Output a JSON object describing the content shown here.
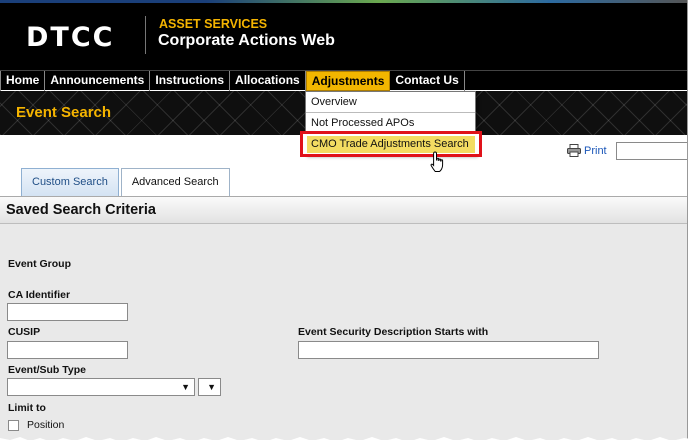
{
  "header": {
    "logo": "DTCC",
    "super_title": "ASSET SERVICES",
    "app_title": "Corporate Actions Web"
  },
  "nav": {
    "items": [
      {
        "label": "Home"
      },
      {
        "label": "Announcements"
      },
      {
        "label": "Instructions"
      },
      {
        "label": "Allocations"
      },
      {
        "label": "Adjustments"
      },
      {
        "label": "Contact Us"
      }
    ],
    "active": "Adjustments"
  },
  "band": {
    "title": "Event Search"
  },
  "dropdown": {
    "items": [
      {
        "label": "Overview"
      },
      {
        "label": "Not Processed APOs"
      },
      {
        "label": "CMO Trade Adjustments Search"
      }
    ],
    "highlighted": "CMO Trade Adjustments Search"
  },
  "print": {
    "label": "Print",
    "input_value": ""
  },
  "tabs": [
    {
      "label": "Custom Search",
      "active": true
    },
    {
      "label": "Advanced Search",
      "active": false
    }
  ],
  "form": {
    "section_title": "Saved Search Criteria",
    "event_group_label": "Event Group",
    "ca_identifier_label": "CA Identifier",
    "ca_identifier_value": "",
    "cusip_label": "CUSIP",
    "cusip_value": "",
    "event_security_label": "Event Security Description Starts with",
    "event_security_value": "",
    "event_subtype_label": "Event/Sub Type",
    "event_type_value": "",
    "sub_type_value": "",
    "limit_to_label": "Limit to",
    "position_label": "Position"
  },
  "colors": {
    "accent": "#f2b600",
    "highlight_border": "#e0121a",
    "link": "#1a56b8"
  }
}
